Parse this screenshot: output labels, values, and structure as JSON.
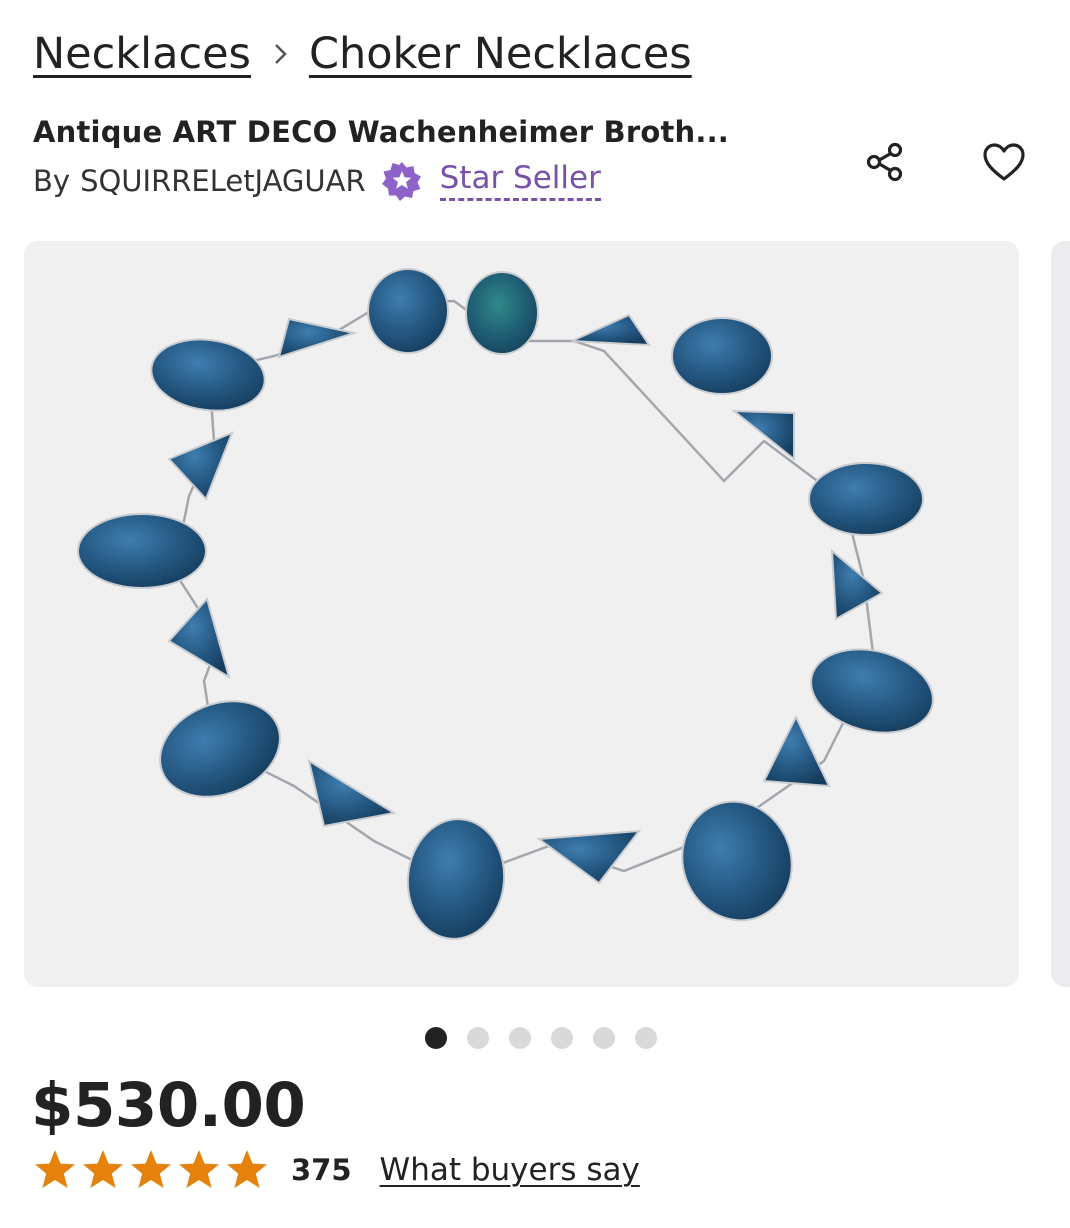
{
  "breadcrumb": {
    "items": [
      {
        "label": "Necklaces"
      },
      {
        "label": "Choker Necklaces"
      }
    ],
    "separator": "›"
  },
  "listing": {
    "title": "Antique ART DECO Wachenheimer Broth...",
    "by_label": "By",
    "seller": "SQUIRRELetJAGUAR",
    "star_seller_label": "Star Seller",
    "price": "$530.00",
    "rating": 5,
    "review_count": "375",
    "buyers_link": "What buyers say"
  },
  "icons": {
    "share": "share-icon",
    "favorite": "heart-icon",
    "badge": "star-seller-badge-icon",
    "rating": "star-icon"
  },
  "carousel": {
    "total_images": 6,
    "active_index": 0
  },
  "colors": {
    "text": "#222222",
    "star_seller": "#7851a9",
    "rating_star": "#e5820d",
    "image_bg": "#f0f0f1",
    "stone": "#2a5e8c"
  }
}
